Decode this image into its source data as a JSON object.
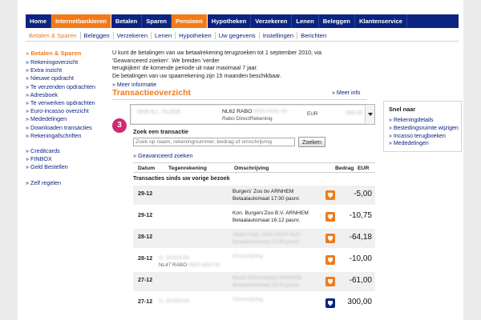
{
  "topnav": [
    "Home",
    "Internetbankieren",
    "Betalen",
    "Sparen",
    "Pensioen",
    "Hypotheken",
    "Verzekeren",
    "Lenen",
    "Beleggen",
    "Klantenservice"
  ],
  "subnav": [
    "Betalen & Sparen",
    "Beleggen",
    "Verzekeren",
    "Lenen",
    "Hypotheken",
    "Uw gegevens",
    "Instellingen",
    "Berichten"
  ],
  "sidebar": {
    "title": "Betalen & Sparen",
    "links": [
      "Rekeningoverzicht",
      "Extra inzicht",
      "Nieuwe opdracht",
      "Te verzenden opdrachten",
      "Adresboek",
      "Te verwerken opdrachten",
      "Euro-incasso overzicht",
      "Mededelingen",
      "Downloaden transacties",
      "Rekeningafschriften"
    ],
    "links2": [
      "Creditcards",
      "FINBOX",
      "Geld Bestellen"
    ],
    "links3": [
      "Zelf regelen"
    ]
  },
  "intro": {
    "line1": "U kunt de betalingen van uw betaalrekening terugzoeken tot 1 september 2010, via 'Geavanceerd zoeken'. We breiden 'verder",
    "line2": "terugkijken' de komende periode uit naar maximaal 7 jaar.",
    "line3": "De betalingen van uw spaarrekening zijn 15 maanden beschikbaar.",
    "more": "Meer informatie"
  },
  "section": {
    "title": "Transactieoverzicht",
    "meer_info": "Meer info"
  },
  "account": {
    "holder": "DHR B.L. PLEEB",
    "iban_prefix": "NL62 RABO",
    "iban_rest": "0000 0000 00",
    "bank": "Rabo DirectRekening",
    "currency": "EUR",
    "amount": "000,00"
  },
  "step_badge": "3",
  "search": {
    "label": "Zoek een transactie",
    "placeholder": "Zoek op naam, rekeningnummer, bedrag of omschrijving",
    "button": "Zoeken",
    "advanced": "Geavanceerd zoeken"
  },
  "table": {
    "headers": {
      "datum": "Datum",
      "tegenrekening": "Tegenrekening",
      "omschrijving": "Omschrijving",
      "bedrag": "Bedrag",
      "eur": "EUR"
    },
    "since_label": "Transacties sinds uw vorige bezoek",
    "rows": [
      {
        "date": "29-12",
        "desc1": "Burgers' Zoo bv ARNHEM",
        "desc2": "Betaalautomaat 17:30 pasnr.",
        "amount": "-5,00"
      },
      {
        "date": "29-12",
        "desc1": "Kon. Burgers'Zoo B.V. ARNHEM",
        "desc2": "Betaalautomaat 16:12 pasnr.",
        "amount": "-10,75"
      },
      {
        "date": "28-12",
        "desc1": "Albert Heijn 1034 VELP GLD",
        "desc2": "Betaalautomaat 12:08 pasnr.",
        "amount": "-64,18"
      },
      {
        "date": "28-12",
        "counterparty": "G. DIJSSUN",
        "account_prefix": "NL47 RABO",
        "account_rest": "0000 0000 00",
        "desc1": "Omschrijving",
        "desc2": "",
        "amount": "-10,00"
      },
      {
        "date": "27-12",
        "desc1": "Musis Schouwburg ARNHEM",
        "desc2": "Betaalautomaat 19:44 pasnr.",
        "amount": "-61,00"
      },
      {
        "date": "27-12",
        "counterparty": "G. DIJSSUN",
        "desc1": "Omschrijving",
        "desc2": "",
        "amount": "300,00"
      }
    ]
  },
  "snel_naar": {
    "title": "Snel naar",
    "links": [
      "Rekeningdetails",
      "Bestedingsruimte wijzigen",
      "Incasso terugboeken",
      "Mededelingen"
    ]
  },
  "colors": {
    "nav_blue": "#0a2480",
    "accent_orange": "#f27a1a",
    "badge_pink": "#d02a72"
  }
}
